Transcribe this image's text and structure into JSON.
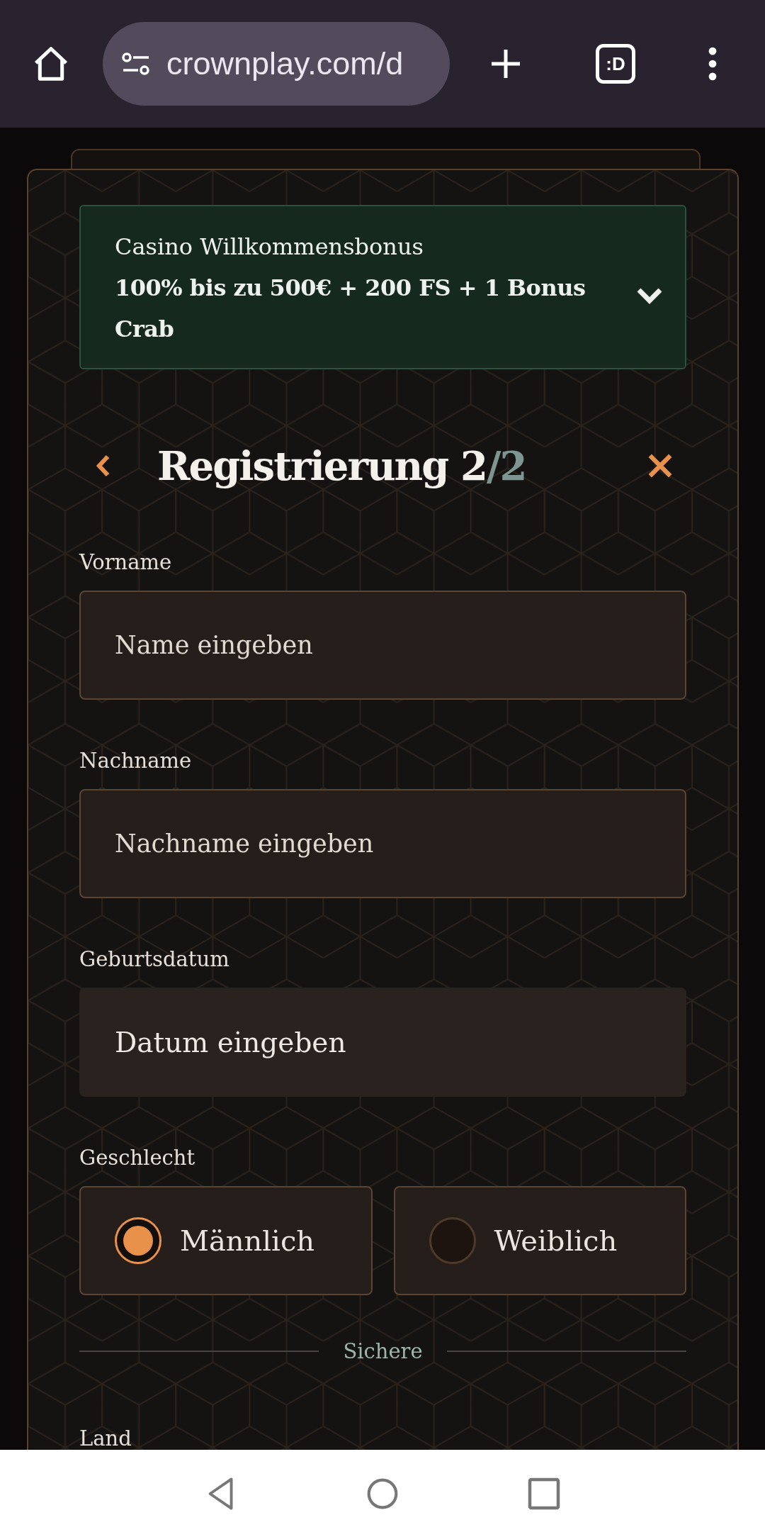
{
  "browser": {
    "url": "crownplay.com/d",
    "tab_label": ":D"
  },
  "bonus": {
    "title": "Casino Willkommensbonus",
    "offer": "100% bis zu 500€ + 200 FS + 1 Bonus Crab"
  },
  "heading": {
    "title": "Registrierung 2",
    "suffix": "/2"
  },
  "fields": [
    {
      "label": "Vorname",
      "placeholder": "Name eingeben",
      "kind": "text"
    },
    {
      "label": "Nachname",
      "placeholder": "Nachname eingeben",
      "kind": "text"
    },
    {
      "label": "Geburtsdatum",
      "placeholder": "Datum eingeben",
      "kind": "date"
    }
  ],
  "gender": {
    "label": "Geschlecht",
    "options": [
      {
        "label": "Männlich",
        "selected": true
      },
      {
        "label": "Weiblich",
        "selected": false
      }
    ]
  },
  "divider": {
    "label": "Sichere"
  },
  "next_field": {
    "label": "Land"
  }
}
